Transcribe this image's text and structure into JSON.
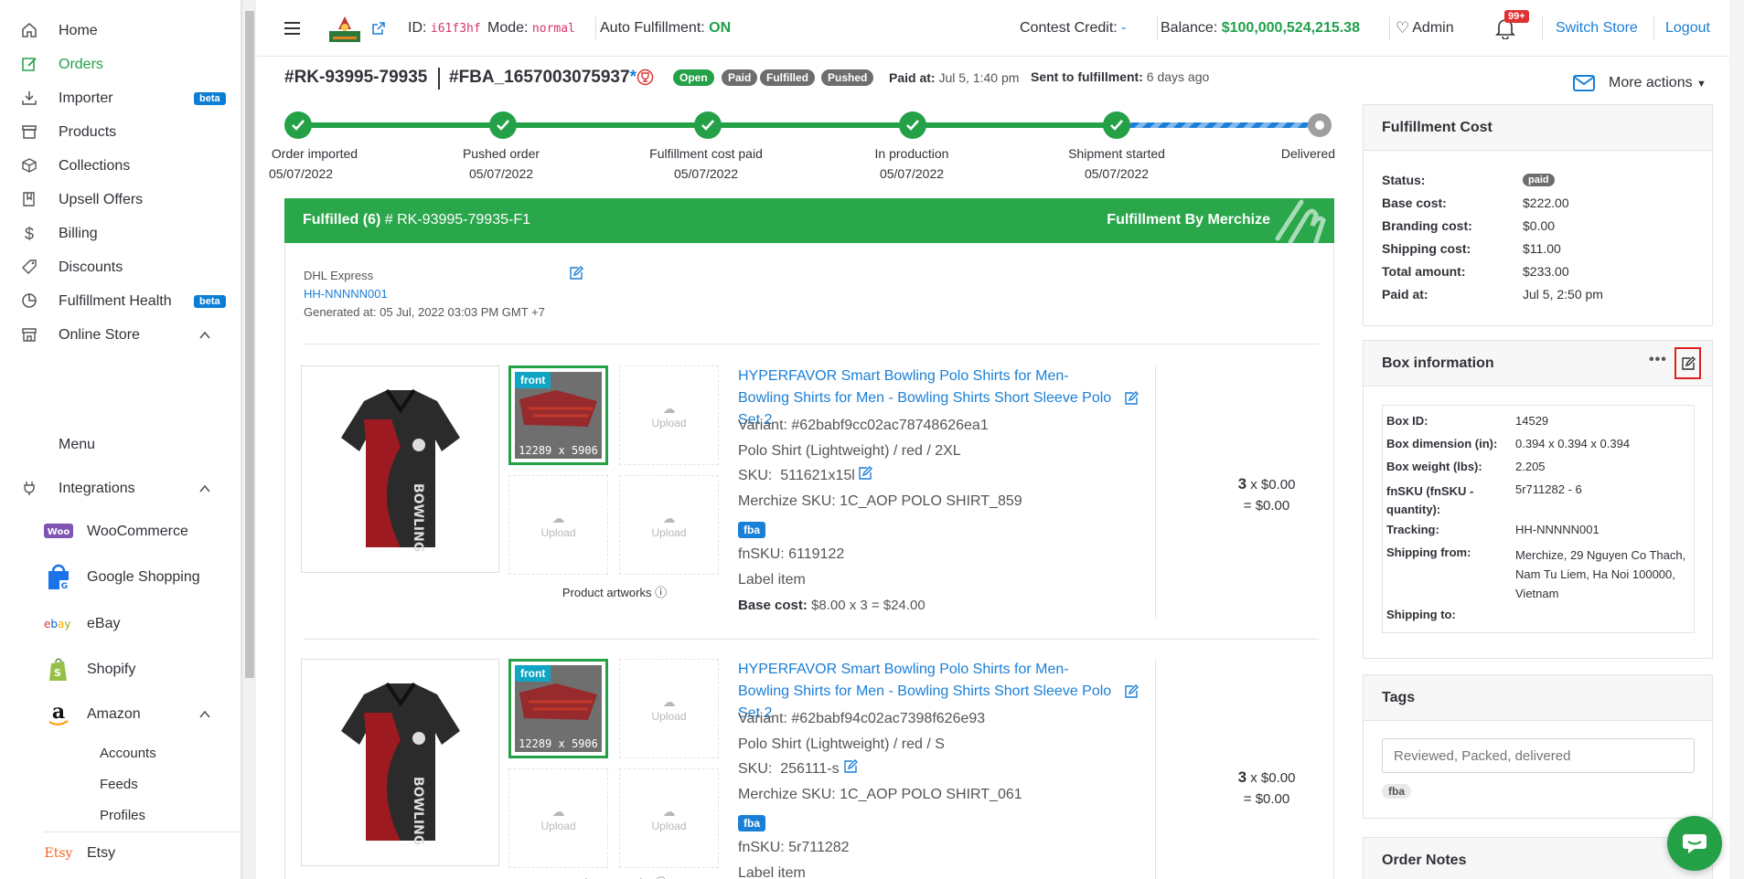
{
  "sidebar": {
    "items": [
      {
        "label": "Home",
        "icon": "home-icon"
      },
      {
        "label": "Orders",
        "icon": "orders-icon"
      },
      {
        "label": "Importer",
        "icon": "importer-icon",
        "badge": "beta"
      },
      {
        "label": "Products",
        "icon": "products-icon"
      },
      {
        "label": "Collections",
        "icon": "collections-icon"
      },
      {
        "label": "Upsell Offers",
        "icon": "upsell-icon"
      },
      {
        "label": "Billing",
        "icon": "dollar-icon"
      },
      {
        "label": "Discounts",
        "icon": "tag-icon"
      },
      {
        "label": "Fulfillment Health",
        "icon": "pie-chart-icon",
        "badge": "beta"
      },
      {
        "label": "Online Store",
        "icon": "store-icon"
      },
      {
        "label": "Integrations",
        "icon": "plug-icon"
      }
    ],
    "online_store_sub": [
      "Menu"
    ],
    "integrations": [
      "WooCommerce",
      "Google Shopping",
      "eBay",
      "Shopify",
      "Amazon",
      "Etsy"
    ],
    "amazon_sub": [
      "Accounts",
      "Feeds",
      "Profiles"
    ]
  },
  "header": {
    "id_label": "ID:",
    "id_value": "i61f3hf",
    "mode_label": "Mode:",
    "mode_value": "normal",
    "auto_label": "Auto Fulfillment:",
    "auto_value": "ON",
    "contest_label": "Contest Credit:",
    "contest_value": "-",
    "balance_label": "Balance:",
    "balance_value": "$100,000,524,215.38",
    "admin": "Admin",
    "notif_count": "99+",
    "switch_store": "Switch Store",
    "logout": "Logout"
  },
  "order": {
    "number": "#RK-93995-79935",
    "fba": "#FBA_1657003075937",
    "asterisk": "*",
    "badges": [
      "Open",
      "Paid",
      "Fulfilled",
      "Pushed"
    ],
    "paid_label": "Paid at:",
    "paid_value": "Jul 5, 1:40 pm",
    "sent_label": "Sent to fulfillment:",
    "sent_value": "6 days ago",
    "more_actions": "More actions"
  },
  "timeline": [
    {
      "label": "Order imported",
      "date": "05/07/2022"
    },
    {
      "label": "Pushed order",
      "date": "05/07/2022"
    },
    {
      "label": "Fulfillment cost paid",
      "date": "05/07/2022"
    },
    {
      "label": "In production",
      "date": "05/07/2022"
    },
    {
      "label": "Shipment started",
      "date": "05/07/2022"
    },
    {
      "label": "Delivered",
      "date": ""
    }
  ],
  "fulfillment": {
    "title": "Fulfilled (6)",
    "number": "# RK-93995-79935-F1",
    "by": "Fulfillment By Merchize",
    "carrier": "DHL Express",
    "tracking": "HH-NNNNN001",
    "generated": "Generated at: 05 Jul, 2022 03:03 PM GMT +7",
    "artworks_label": "Product artworks",
    "upload": "Upload",
    "front": "front",
    "dims": "12289 x 5906",
    "items": [
      {
        "title": "HYPERFAVOR Smart Bowling Polo Shirts for Men- Bowling Shirts for Men - Bowling Shirts Short Sleeve Polo Set 2",
        "variant": "Variant: #62babf9cc02ac78748626ea1",
        "option": "Polo Shirt (Lightweight) / red / 2XL",
        "sku_label": "SKU:",
        "sku": "511621x15l",
        "merchize_sku": "Merchize SKU: 1C_AOP POLO SHIRT_859",
        "tag": "fba",
        "fnsku": "fnSKU: 6119122",
        "label_item": "Label item",
        "base_cost_label": "Base cost:",
        "base_cost": "$8.00 x 3 = $24.00",
        "qty": "3",
        "unit": "x $0.00",
        "total": "= $0.00"
      },
      {
        "title": "HYPERFAVOR Smart Bowling Polo Shirts for Men- Bowling Shirts for Men - Bowling Shirts Short Sleeve Polo Set 2",
        "variant": "Variant: #62babf94c02ac7398f626e93",
        "option": "Polo Shirt (Lightweight) / red / S",
        "sku_label": "SKU:",
        "sku": "256111-s",
        "merchize_sku": "Merchize SKU: 1C_AOP POLO SHIRT_061",
        "tag": "fba",
        "fnsku": "fnSKU: 5r711282",
        "label_item": "Label item",
        "qty": "3",
        "unit": "x $0.00",
        "total": "= $0.00"
      }
    ]
  },
  "cost_panel": {
    "title": "Fulfillment Cost",
    "rows": [
      {
        "label": "Status:",
        "value": "paid"
      },
      {
        "label": "Base cost:",
        "value": "$222.00"
      },
      {
        "label": "Branding cost:",
        "value": "$0.00"
      },
      {
        "label": "Shipping cost:",
        "value": "$11.00"
      },
      {
        "label": "Total amount:",
        "value": "$233.00"
      },
      {
        "label": "Paid at:",
        "value": "Jul 5, 2:50 pm"
      }
    ]
  },
  "box_panel": {
    "title": "Box information",
    "rows": [
      {
        "label": "Box ID:",
        "value": "14529"
      },
      {
        "label": "Box dimension (in):",
        "value": "0.394 x 0.394 x 0.394"
      },
      {
        "label": "Box weight (lbs):",
        "value": "2.205"
      },
      {
        "label": "fnSKU (fnSKU - quantity):",
        "value": "5r711282 - 6"
      },
      {
        "label": "Tracking:",
        "value": "HH-NNNNN001"
      },
      {
        "label": "Shipping from:",
        "value": "Merchize, 29 Nguyen Co Thach, Nam Tu Liem, Ha Noi 100000, Vietnam"
      },
      {
        "label": "Shipping to:",
        "value": ""
      }
    ]
  },
  "tags_panel": {
    "title": "Tags",
    "placeholder": "Reviewed, Packed, delivered",
    "tags": [
      "fba"
    ]
  },
  "notes_panel": {
    "title": "Order Notes"
  },
  "colors": {
    "accent_green": "#24a047",
    "link_blue": "#1a7fd6",
    "highlight_red": "#e02020"
  }
}
